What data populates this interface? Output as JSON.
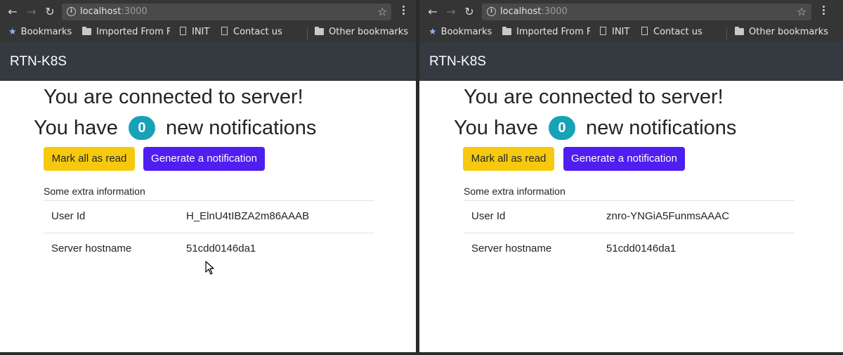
{
  "windows": [
    {
      "url": {
        "host": "localhost",
        "port": ":3000"
      },
      "bookmarks": [
        {
          "label": "Bookmarks",
          "icon": "star-icon"
        },
        {
          "label": "Imported From F",
          "icon": "folder-icon"
        },
        {
          "label": "INIT",
          "icon": "page-icon"
        },
        {
          "label": "Contact us",
          "icon": "page-icon"
        },
        {
          "label": "Other bookmarks",
          "icon": "folder-icon"
        }
      ],
      "brand": "RTN-K8S",
      "heading_connected": "You are connected to server!",
      "notif_prefix": "You have",
      "notif_count": "0",
      "notif_suffix": "new notifications",
      "buttons": {
        "mark_read": "Mark all as read",
        "generate": "Generate a notification"
      },
      "extra_title": "Some extra information",
      "info": [
        {
          "key": "User Id",
          "value": "H_ElnU4tIBZA2m86AAAB"
        },
        {
          "key": "Server hostname",
          "value": "51cdd0146da1"
        }
      ]
    },
    {
      "url": {
        "host": "localhost",
        "port": ":3000"
      },
      "bookmarks": [
        {
          "label": "Bookmarks",
          "icon": "star-icon"
        },
        {
          "label": "Imported From F",
          "icon": "folder-icon"
        },
        {
          "label": "INIT",
          "icon": "page-icon"
        },
        {
          "label": "Contact us",
          "icon": "page-icon"
        },
        {
          "label": "Other bookmarks",
          "icon": "folder-icon"
        }
      ],
      "brand": "RTN-K8S",
      "heading_connected": "You are connected to server!",
      "notif_prefix": "You have",
      "notif_count": "0",
      "notif_suffix": "new notifications",
      "buttons": {
        "mark_read": "Mark all as read",
        "generate": "Generate a notification"
      },
      "extra_title": "Some extra information",
      "info": [
        {
          "key": "User Id",
          "value": "znro-YNGiA5FunmsAAAC"
        },
        {
          "key": "Server hostname",
          "value": "51cdd0146da1"
        }
      ]
    }
  ],
  "colors": {
    "navbar": "#343a40",
    "badge": "#17a2b8",
    "mark_read_button": "#f6c90e",
    "generate_button": "#4f1ef0"
  }
}
